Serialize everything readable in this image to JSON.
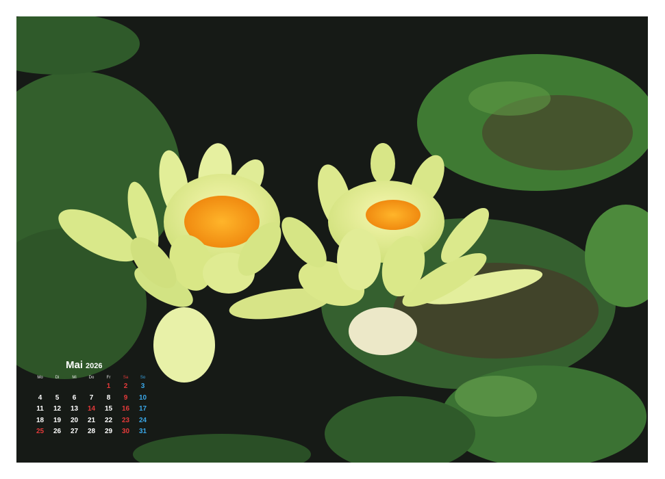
{
  "calendar": {
    "month": "Mai",
    "year": "2026",
    "weekdays": [
      "Mo",
      "Di",
      "Mi",
      "Do",
      "Fr",
      "Sa",
      "So"
    ],
    "leading_blanks": 4,
    "days": [
      "1",
      "2",
      "3",
      "4",
      "5",
      "6",
      "7",
      "8",
      "9",
      "10",
      "11",
      "12",
      "13",
      "14",
      "15",
      "16",
      "17",
      "18",
      "19",
      "20",
      "21",
      "22",
      "23",
      "24",
      "25",
      "26",
      "27",
      "28",
      "29",
      "30",
      "31"
    ],
    "holidays": [
      "1",
      "14",
      "25"
    ],
    "colors": {
      "text": "#ffffff",
      "weekend_sat": "#e43a3a",
      "weekend_sun": "#3aa7e8",
      "holiday": "#e43a3a"
    }
  },
  "photo": {
    "subject": "water-lily-icon",
    "colors": {
      "water": "#161a16",
      "pad_green": "#3f7a33",
      "pad_dark": "#2a4a28",
      "petal": "#e8f0a0",
      "stamen": "#f3a21c"
    }
  }
}
